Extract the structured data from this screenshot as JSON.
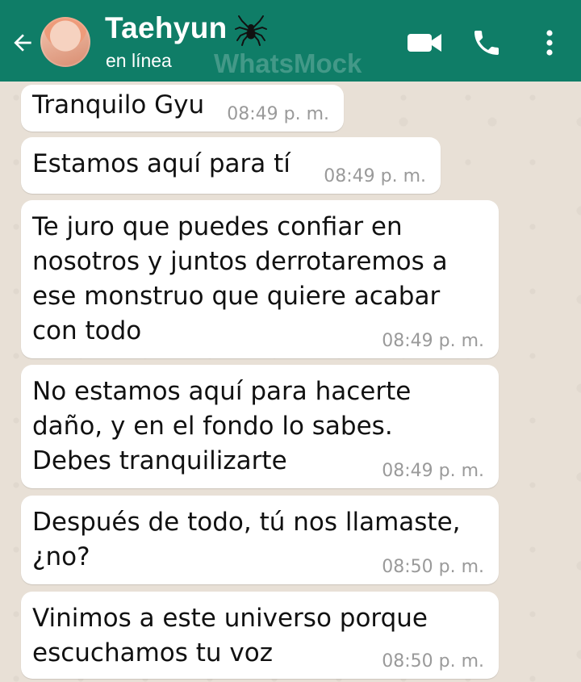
{
  "header": {
    "contact_name": "Taehyun",
    "status": "en línea",
    "watermark": "WhatsMock",
    "icons": {
      "back": "back-arrow-icon",
      "avatar": "contact-avatar",
      "name_emoji": "spider-icon",
      "video": "video-call-icon",
      "call": "phone-icon",
      "menu": "more-vert-icon"
    }
  },
  "messages": [
    {
      "text": "Tranquilo Gyu",
      "time": "08:49 p. m."
    },
    {
      "text": "Estamos aquí para tí",
      "time": "08:49 p. m."
    },
    {
      "text": "Te juro que puedes confiar en\nnosotros y juntos derrotaremos a\nese monstruo que quiere acabar\ncon todo",
      "time": "08:49 p. m."
    },
    {
      "text": "No estamos aquí para hacerte\ndaño, y en el fondo lo sabes.\nDebes tranquilizarte",
      "time": "08:49 p. m."
    },
    {
      "text": "Después de todo, tú nos llamaste,\n¿no?",
      "time": "08:50 p. m."
    },
    {
      "text": "Vinimos a este universo porque\nescuchamos tu voz",
      "time": "08:50 p. m."
    }
  ],
  "colors": {
    "header_bg": "#0f7d67",
    "chat_bg": "#e8e0d6",
    "bubble_bg": "#ffffff",
    "time_text": "#9a9a9a"
  }
}
